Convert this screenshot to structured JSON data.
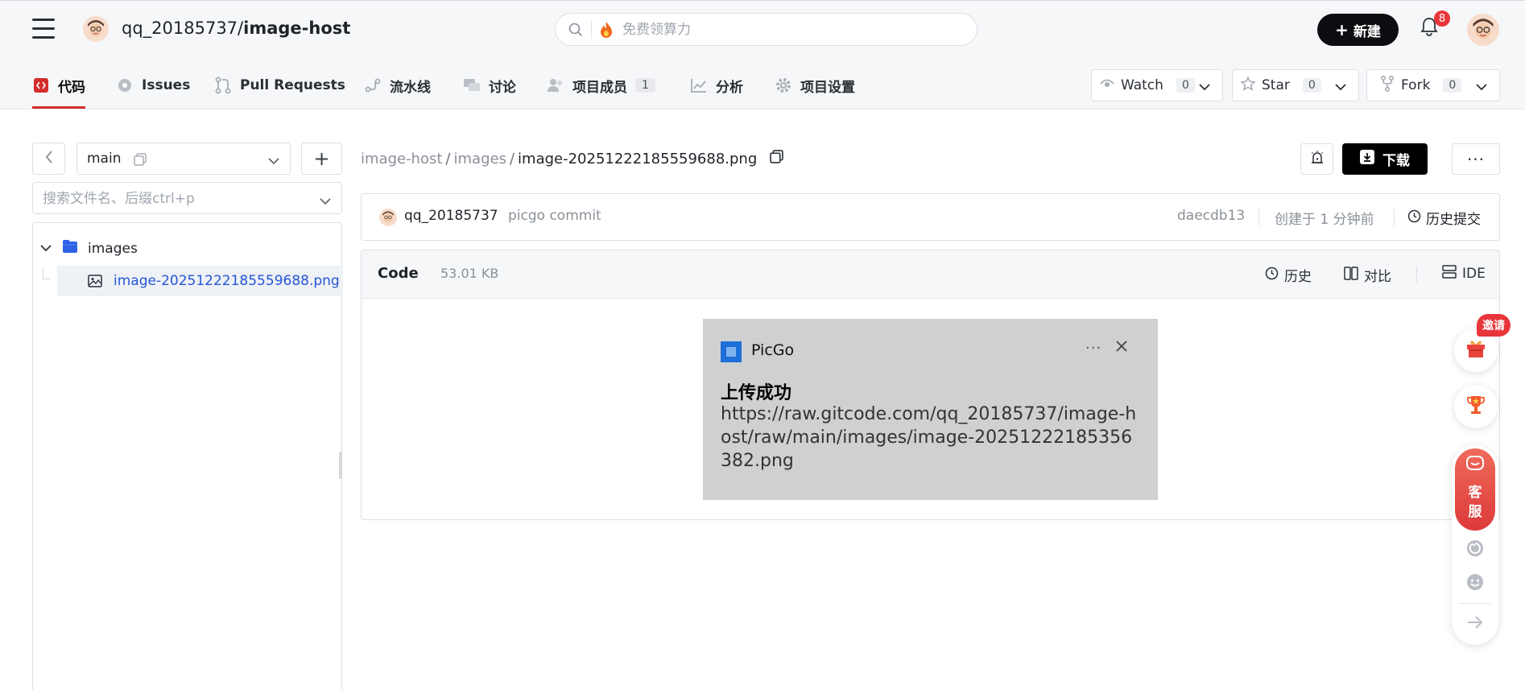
{
  "header": {
    "owner": "qq_20185737/",
    "repo": "image-host",
    "search_placeholder": "免费领算力",
    "new_button": "新建",
    "notification_count": "8"
  },
  "tabs": [
    {
      "label": "代码"
    },
    {
      "label": "Issues"
    },
    {
      "label": "Pull Requests"
    },
    {
      "label": "流水线"
    },
    {
      "label": "讨论"
    },
    {
      "label": "项目成员",
      "count": "1"
    },
    {
      "label": "分析"
    },
    {
      "label": "项目设置"
    }
  ],
  "repo_actions": {
    "watch": {
      "label": "Watch",
      "count": "0"
    },
    "star": {
      "label": "Star",
      "count": "0"
    },
    "fork": {
      "label": "Fork",
      "count": "0"
    }
  },
  "sidebar": {
    "branch": "main",
    "file_search_placeholder": "搜索文件名、后缀ctrl+p",
    "folder": "images",
    "file": "image-20251222185559688.png"
  },
  "breadcrumb": {
    "root": "image-host",
    "folder": "images",
    "file": "image-20251222185559688.png"
  },
  "download_button": "下载",
  "commit": {
    "author": "qq_20185737",
    "message": "picgo commit",
    "sha": "daecdb13",
    "created": "创建于 1 分钟前",
    "history": "历史提交"
  },
  "code_panel": {
    "title": "Code",
    "size": "53.01 KB",
    "history": "历史",
    "compare": "对比",
    "ide": "IDE"
  },
  "preview_image": {
    "app_name": "PicGo",
    "heading": "上传成功",
    "url": "https://raw.gitcode.com/qq_20185737/image-host/raw/main/images/image-20251222185356382.png"
  },
  "floating": {
    "invite": "邀请",
    "support_line1": "客",
    "support_line2": "服"
  },
  "colors": {
    "accent_red": "#d52d2d",
    "link_blue": "#2456d6",
    "badge_red": "#e8353a"
  }
}
